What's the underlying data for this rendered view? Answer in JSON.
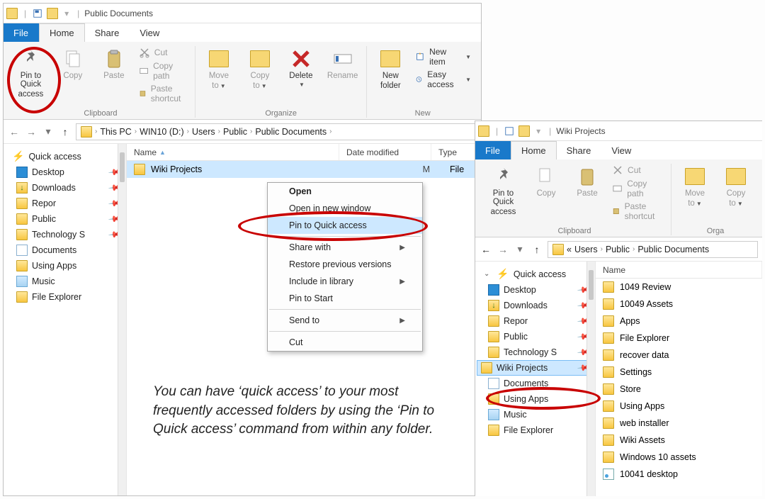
{
  "win1": {
    "title": "Public Documents",
    "tabs": {
      "file": "File",
      "home": "Home",
      "share": "Share",
      "view": "View"
    },
    "ribbon": {
      "pin": {
        "line1": "Pin to Quick",
        "line2": "access"
      },
      "copy": "Copy",
      "paste": "Paste",
      "cut": "Cut",
      "copypath": "Copy path",
      "pastesc": "Paste shortcut",
      "moveto": {
        "line1": "Move",
        "line2": "to"
      },
      "copyto": {
        "line1": "Copy",
        "line2": "to"
      },
      "delete": "Delete",
      "rename": "Rename",
      "newfolder": {
        "line1": "New",
        "line2": "folder"
      },
      "newitem": "New item",
      "easyaccess": "Easy access",
      "grp_clipboard": "Clipboard",
      "grp_organize": "Organize",
      "grp_new": "New"
    },
    "breadcrumb": [
      "This PC",
      "WIN10 (D:)",
      "Users",
      "Public",
      "Public Documents"
    ],
    "columns": {
      "name": "Name",
      "date": "Date modified",
      "type": "Type"
    },
    "sidebar": {
      "quickaccess": "Quick access",
      "items": [
        {
          "label": "Desktop",
          "icon": "desk",
          "pinned": true
        },
        {
          "label": "Downloads",
          "icon": "dl",
          "pinned": true
        },
        {
          "label": "Repor",
          "icon": "folder",
          "pinned": true
        },
        {
          "label": "Public",
          "icon": "folder",
          "pinned": true
        },
        {
          "label": "Technology S",
          "icon": "folder",
          "pinned": true
        },
        {
          "label": "Documents",
          "icon": "doc",
          "pinned": false
        },
        {
          "label": "Using Apps",
          "icon": "folder",
          "pinned": false
        },
        {
          "label": "Music",
          "icon": "music",
          "pinned": false
        },
        {
          "label": "File Explorer",
          "icon": "folder",
          "pinned": false
        }
      ]
    },
    "filerow": {
      "name": "Wiki Projects",
      "datestub": "M",
      "typestub": "File "
    },
    "ctx": {
      "open": "Open",
      "openwin": "Open in new window",
      "pinqa": "Pin to Quick access",
      "sharewith": "Share with",
      "restore": "Restore previous versions",
      "include": "Include in library",
      "pinstart": "Pin to Start",
      "sendto": "Send to",
      "cut": "Cut"
    }
  },
  "win2": {
    "title": "Wiki Projects",
    "tabs": {
      "file": "File",
      "home": "Home",
      "share": "Share",
      "view": "View"
    },
    "ribbon": {
      "pin": {
        "line1": "Pin to Quick",
        "line2": "access"
      },
      "copy": "Copy",
      "paste": "Paste",
      "cut": "Cut",
      "copypath": "Copy path",
      "pastesc": "Paste shortcut",
      "moveto": {
        "line1": "Move",
        "line2": "to"
      },
      "copyto": {
        "line1": "Copy",
        "line2": "to"
      },
      "grp_clipboard": "Clipboard",
      "grp_org": "Orga"
    },
    "breadcrumb_head": "«",
    "breadcrumb": [
      "Users",
      "Public",
      "Public Documents"
    ],
    "columns": {
      "name": "Name"
    },
    "sidebar": {
      "quickaccess": "Quick access",
      "items": [
        {
          "label": "Desktop",
          "icon": "desk",
          "pinned": true
        },
        {
          "label": "Downloads",
          "icon": "dl",
          "pinned": true
        },
        {
          "label": "Repor",
          "icon": "folder",
          "pinned": true
        },
        {
          "label": "Public",
          "icon": "folder",
          "pinned": true
        },
        {
          "label": "Technology S",
          "icon": "folder",
          "pinned": true
        },
        {
          "label": "Wiki Projects",
          "icon": "folder",
          "pinned": true,
          "selected": true
        },
        {
          "label": "Documents",
          "icon": "doc",
          "pinned": false
        },
        {
          "label": "Using Apps",
          "icon": "folder",
          "pinned": false
        },
        {
          "label": "Music",
          "icon": "music",
          "pinned": false
        },
        {
          "label": "File Explorer",
          "icon": "folder",
          "pinned": false
        }
      ]
    },
    "files": [
      {
        "label": "1049 Review",
        "icon": "folder"
      },
      {
        "label": "10049 Assets",
        "icon": "folder"
      },
      {
        "label": "Apps",
        "icon": "folder"
      },
      {
        "label": "File Explorer",
        "icon": "folder"
      },
      {
        "label": "recover data",
        "icon": "folder"
      },
      {
        "label": "Settings",
        "icon": "folder"
      },
      {
        "label": "Store",
        "icon": "folder"
      },
      {
        "label": "Using Apps",
        "icon": "folder"
      },
      {
        "label": "web installer",
        "icon": "folder"
      },
      {
        "label": "Wiki Assets",
        "icon": "folder"
      },
      {
        "label": "Windows 10 assets",
        "icon": "folder"
      },
      {
        "label": "10041 desktop",
        "icon": "img"
      }
    ]
  },
  "caption": "You can have ‘quick access’ to your most frequently accessed folders by using the ‘Pin to Quick access’ command from within any folder."
}
